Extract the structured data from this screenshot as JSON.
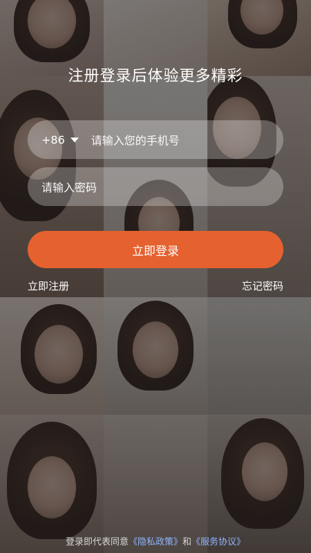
{
  "headline": "注册登录后体验更多精彩",
  "phone_field": {
    "country_code": "+86",
    "country_dropdown_icon": "caret-down-icon",
    "placeholder": "请输入您的手机号"
  },
  "password_field": {
    "placeholder": "请输入密码"
  },
  "login_button": {
    "label": "立即登录",
    "color": "#e5612f"
  },
  "links": {
    "register": "立即注册",
    "forgot_password": "忘记密码"
  },
  "agreement": {
    "prefix": "登录即代表同意",
    "privacy_policy": "《隐私政策》",
    "conjunction": "和",
    "service_agreement": "《服务协议》",
    "link_color": "#8fb3ff"
  }
}
